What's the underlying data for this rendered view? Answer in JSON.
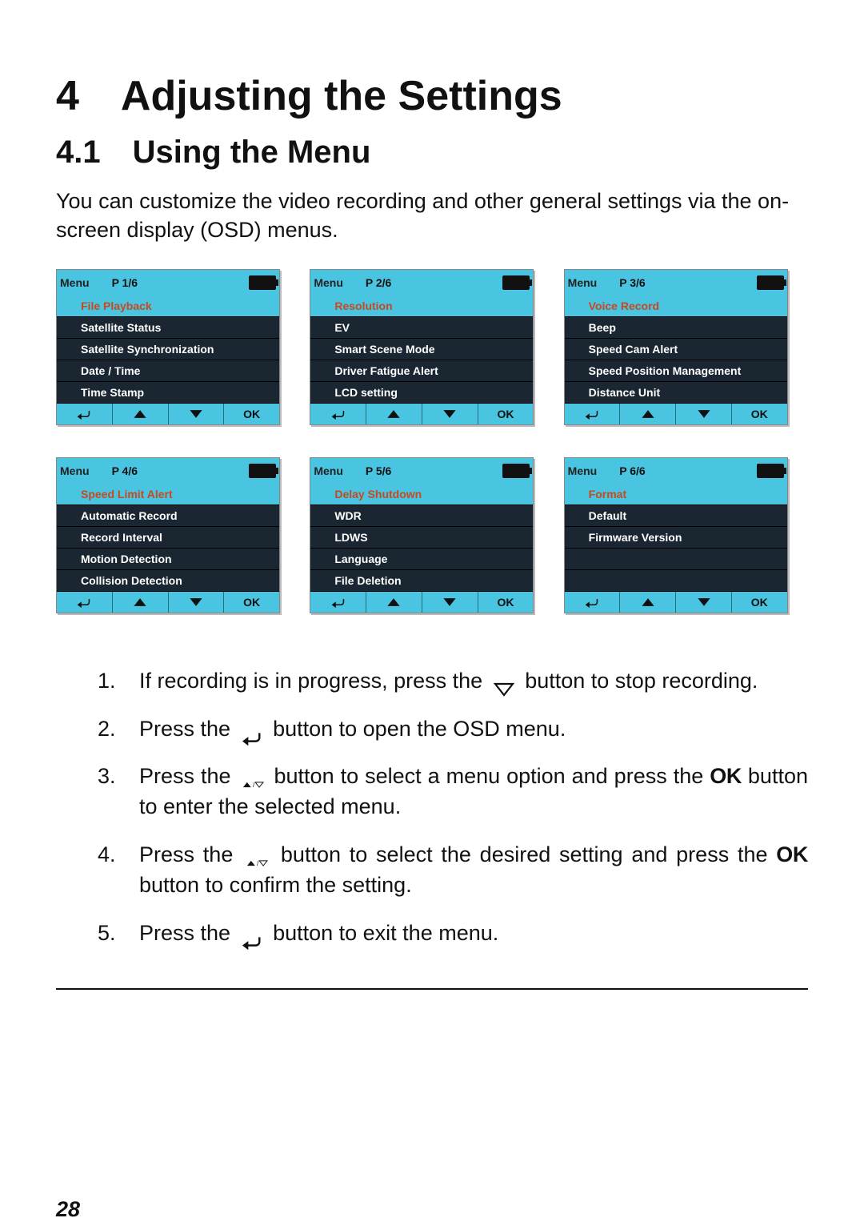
{
  "headings": {
    "h1": "4 Adjusting the Settings",
    "h2": "4.1 Using the Menu"
  },
  "intro": "You can customize the video recording and other general settings via the on-screen display (OSD) menus.",
  "menu_header_label": "Menu",
  "footer_ok": "OK",
  "menus": [
    {
      "page": "P 1/6",
      "items": [
        {
          "label": "File Playback",
          "selected": true
        },
        {
          "label": "Satellite Status"
        },
        {
          "label": "Satellite Synchronization"
        },
        {
          "label": "Date / Time"
        },
        {
          "label": "Time Stamp"
        }
      ]
    },
    {
      "page": "P 2/6",
      "items": [
        {
          "label": "Resolution",
          "selected": true
        },
        {
          "label": "EV"
        },
        {
          "label": "Smart Scene Mode"
        },
        {
          "label": "Driver Fatigue Alert"
        },
        {
          "label": "LCD setting"
        }
      ]
    },
    {
      "page": "P 3/6",
      "items": [
        {
          "label": "Voice Record",
          "selected": true
        },
        {
          "label": "Beep"
        },
        {
          "label": "Speed Cam Alert"
        },
        {
          "label": "Speed Position Management"
        },
        {
          "label": "Distance Unit"
        }
      ]
    },
    {
      "page": "P 4/6",
      "items": [
        {
          "label": "Speed Limit Alert",
          "selected": true
        },
        {
          "label": "Automatic Record"
        },
        {
          "label": "Record Interval"
        },
        {
          "label": "Motion Detection"
        },
        {
          "label": "Collision Detection"
        }
      ]
    },
    {
      "page": "P 5/6",
      "items": [
        {
          "label": "Delay Shutdown",
          "selected": true
        },
        {
          "label": "WDR"
        },
        {
          "label": "LDWS"
        },
        {
          "label": "Language"
        },
        {
          "label": "File Deletion"
        }
      ]
    },
    {
      "page": "P 6/6",
      "items": [
        {
          "label": "Format",
          "selected": true
        },
        {
          "label": "Default"
        },
        {
          "label": "Firmware Version"
        },
        {
          "label": ""
        },
        {
          "label": ""
        }
      ]
    }
  ],
  "steps": {
    "s1a": "If recording is in progress, press the ",
    "s1b": " button to stop recording.",
    "s2a": "Press the ",
    "s2b": " button to open the OSD menu.",
    "s3a": "Press the ",
    "s3b": " button to select a menu option and press the ",
    "s3c": " button to enter the selected menu.",
    "s4a": "Press the ",
    "s4b": " button to select the desired setting and press the ",
    "s4c": " button to confirm the setting.",
    "s5a": "Press the ",
    "s5b": " button to exit the menu.",
    "ok": "OK"
  },
  "page_number": "28"
}
